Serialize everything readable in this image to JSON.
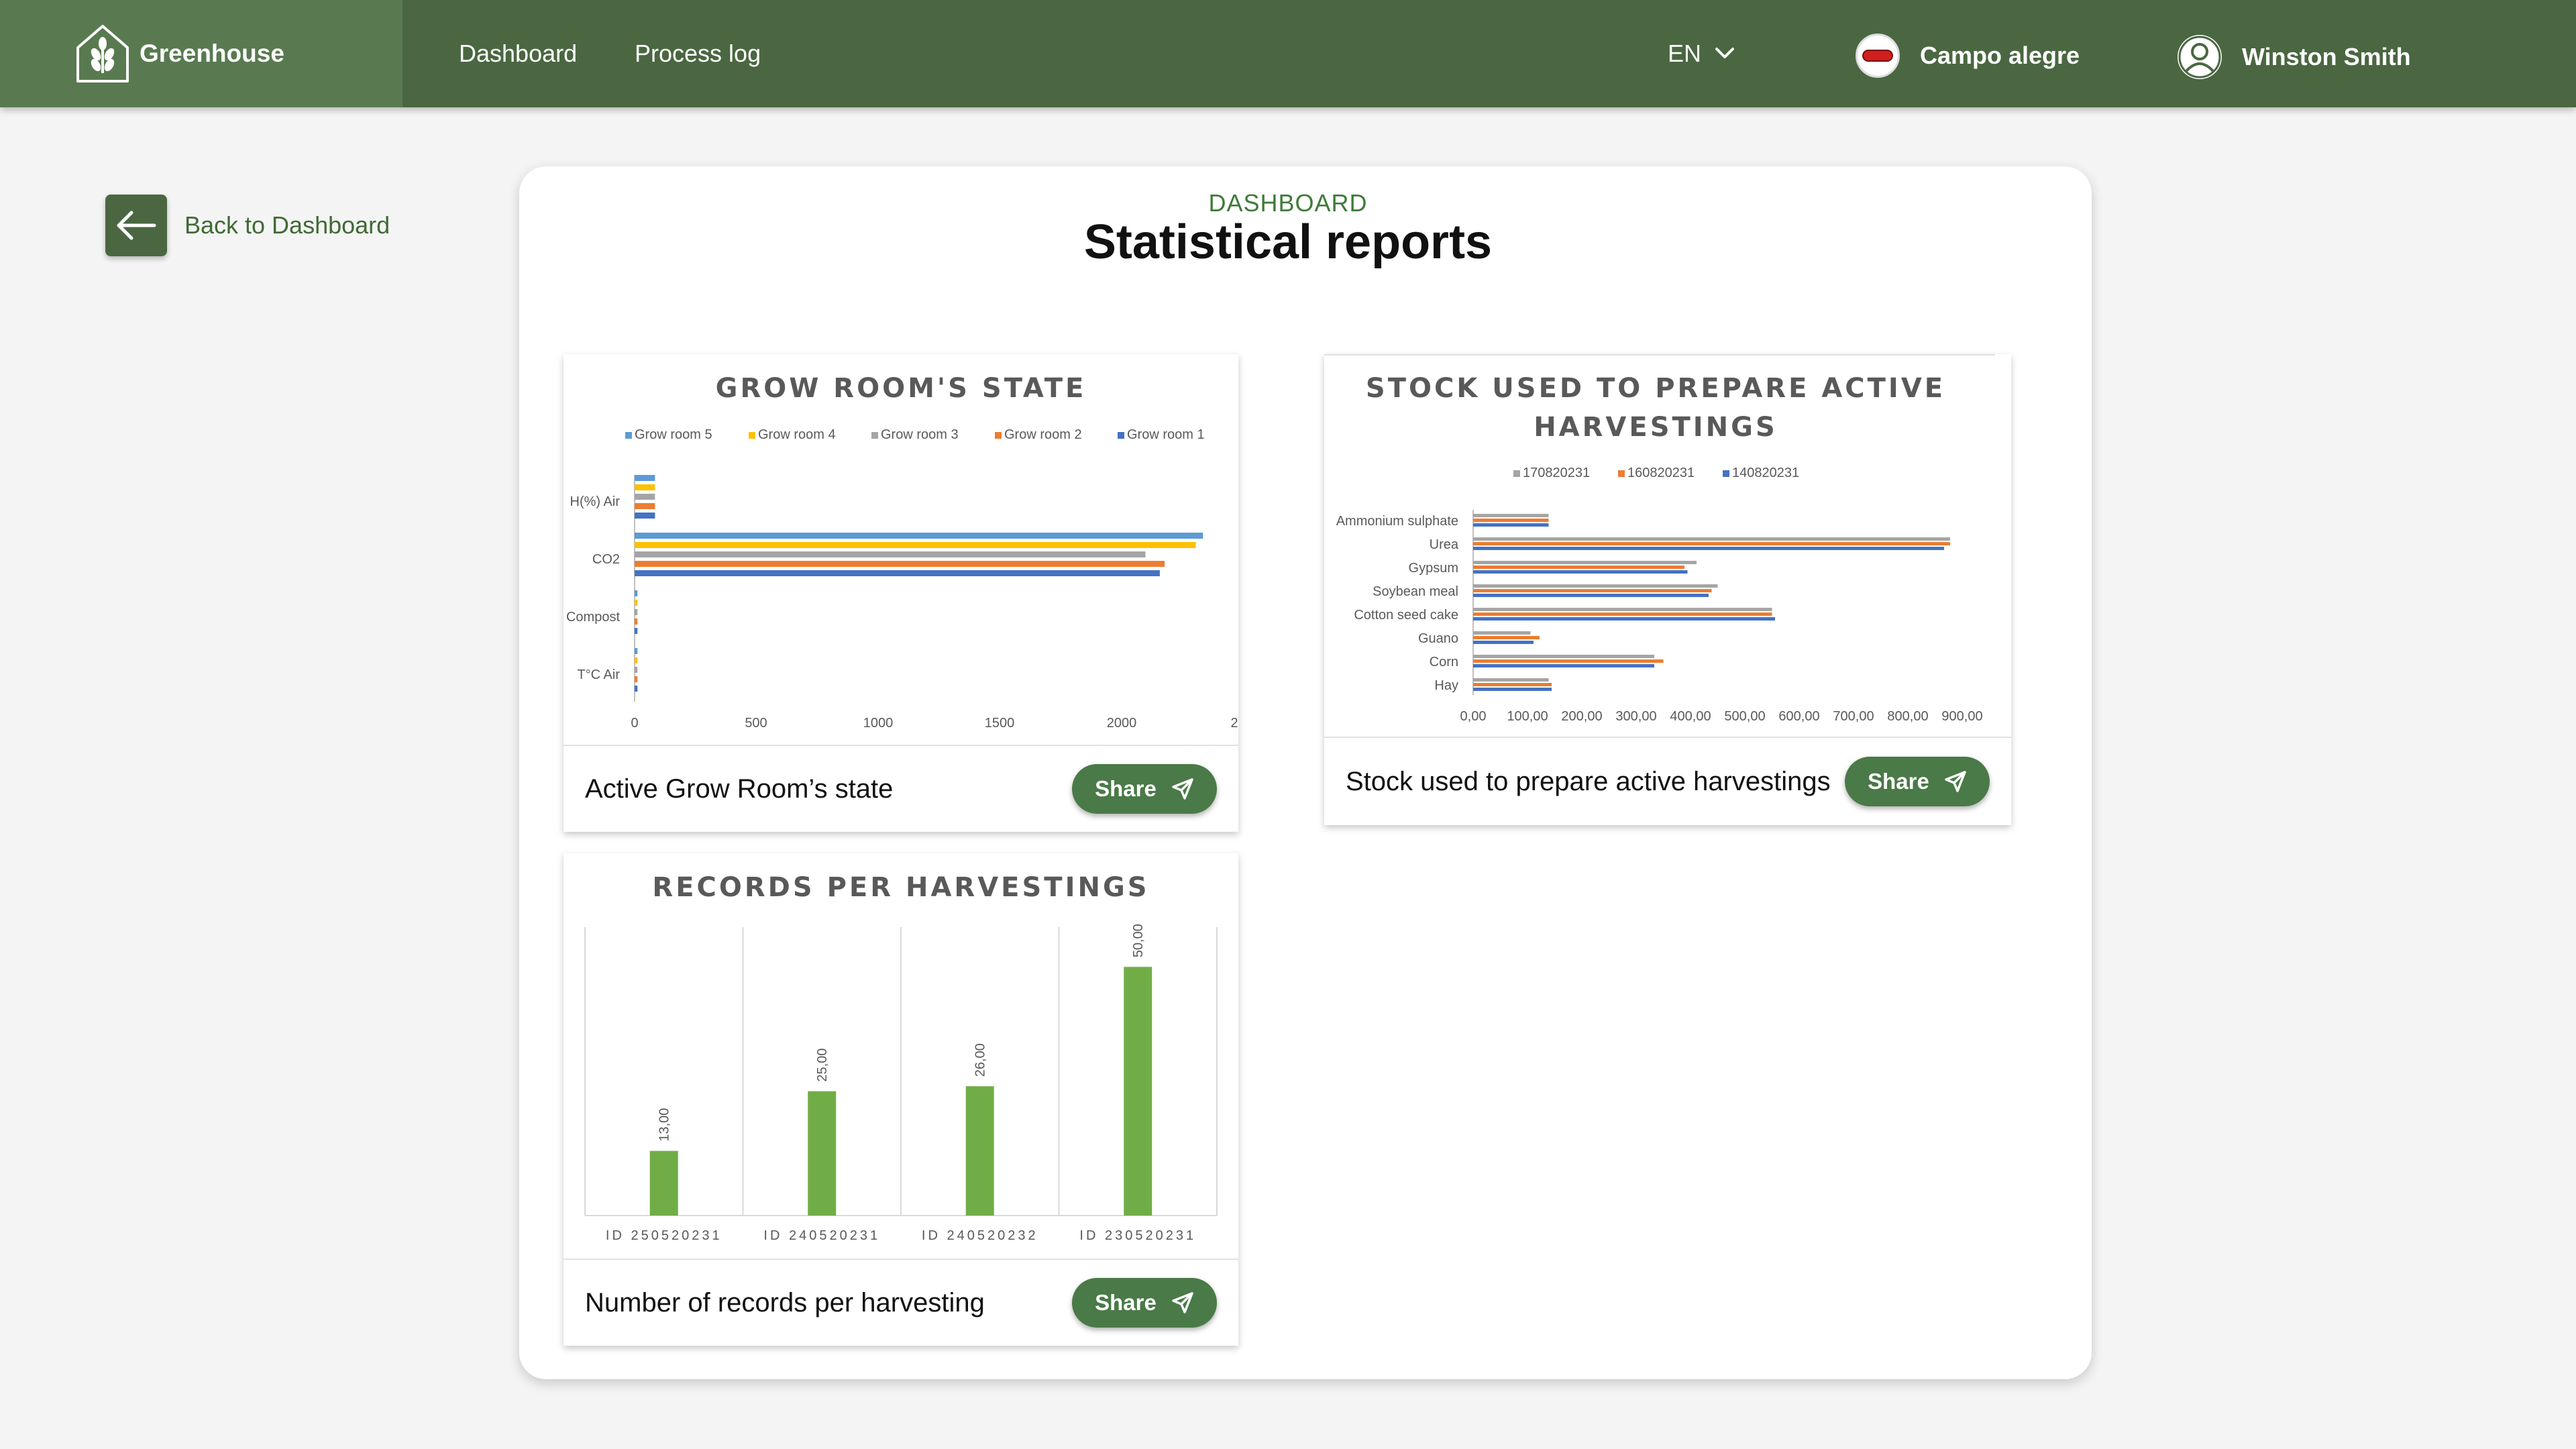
{
  "app": {
    "name": "Greenhouse"
  },
  "nav": {
    "dashboard": "Dashboard",
    "process_log": "Process log"
  },
  "language": {
    "selected": "EN"
  },
  "farm": {
    "name": "Campo alegre"
  },
  "user": {
    "name": "Winston Smith"
  },
  "back": {
    "label": "Back to Dashboard"
  },
  "page": {
    "eyebrow": "DASHBOARD",
    "title": "Statistical reports"
  },
  "colors": {
    "primary": "#4a6741",
    "accent": "#4a7a47",
    "bar_green": "#70ad47"
  },
  "cards": [
    {
      "label": "Active Grow Room’s state",
      "share": "Share"
    },
    {
      "label": "Stock used to prepare active harvestings",
      "share": "Share"
    },
    {
      "label": "Number of records per harvesting",
      "share": "Share"
    }
  ],
  "chart_data": [
    {
      "type": "bar",
      "orientation": "horizontal",
      "title": "GROW ROOM'S STATE",
      "categories": [
        "H(%) Air",
        "CO2",
        "Compost",
        "T°C Air"
      ],
      "xlim": [
        0,
        2400
      ],
      "xticks": [
        "0",
        "500",
        "1000",
        "1500",
        "2000",
        "2"
      ],
      "legend_position": "top",
      "series": [
        {
          "name": "Grow room 5",
          "color": "#5b9bd5",
          "values": [
            85,
            2370,
            12,
            12
          ]
        },
        {
          "name": "Grow room 4",
          "color": "#ffc000",
          "values": [
            85,
            2340,
            12,
            12
          ]
        },
        {
          "name": "Grow room 3",
          "color": "#a5a5a5",
          "values": [
            85,
            2130,
            12,
            12
          ]
        },
        {
          "name": "Grow room 2",
          "color": "#ed7d31",
          "values": [
            85,
            2210,
            12,
            12
          ]
        },
        {
          "name": "Grow room 1",
          "color": "#4472c4",
          "values": [
            85,
            2190,
            12,
            12
          ]
        }
      ]
    },
    {
      "type": "bar",
      "orientation": "horizontal",
      "title": "STOCK USED TO PREPARE ACTIVE HARVESTINGS",
      "title_lines": [
        "STOCK USED TO PREPARE ACTIVE",
        "HARVESTINGS"
      ],
      "categories": [
        "Ammonium sulphate",
        "Urea",
        "Gypsum",
        "Soybean meal",
        "Cotton seed cake",
        "Guano",
        "Corn",
        "Hay"
      ],
      "xlim": [
        0,
        900
      ],
      "xticks": [
        "0,00",
        "100,00",
        "200,00",
        "300,00",
        "400,00",
        "500,00",
        "600,00",
        "700,00",
        "800,00",
        "900,00"
      ],
      "legend_position": "top",
      "series": [
        {
          "name": "170820231",
          "color": "#a5a5a5",
          "values": [
            125,
            790,
            370,
            405,
            495,
            95,
            300,
            125
          ]
        },
        {
          "name": "160820231",
          "color": "#ed7d31",
          "values": [
            125,
            790,
            350,
            395,
            495,
            110,
            315,
            130
          ]
        },
        {
          "name": "140820231",
          "color": "#4472c4",
          "values": [
            125,
            780,
            355,
            390,
            500,
            100,
            300,
            130
          ]
        }
      ]
    },
    {
      "type": "bar",
      "title": "RECORDS PER HARVESTINGS",
      "categories": [
        "ID 250520231",
        "ID 240520231",
        "ID 240520232",
        "ID 230520231"
      ],
      "values": [
        13,
        25,
        26,
        50
      ],
      "data_labels": [
        "13,00",
        "25,00",
        "26,00",
        "50,00"
      ],
      "ylim": [
        0,
        58
      ],
      "color": "#70ad47"
    }
  ]
}
